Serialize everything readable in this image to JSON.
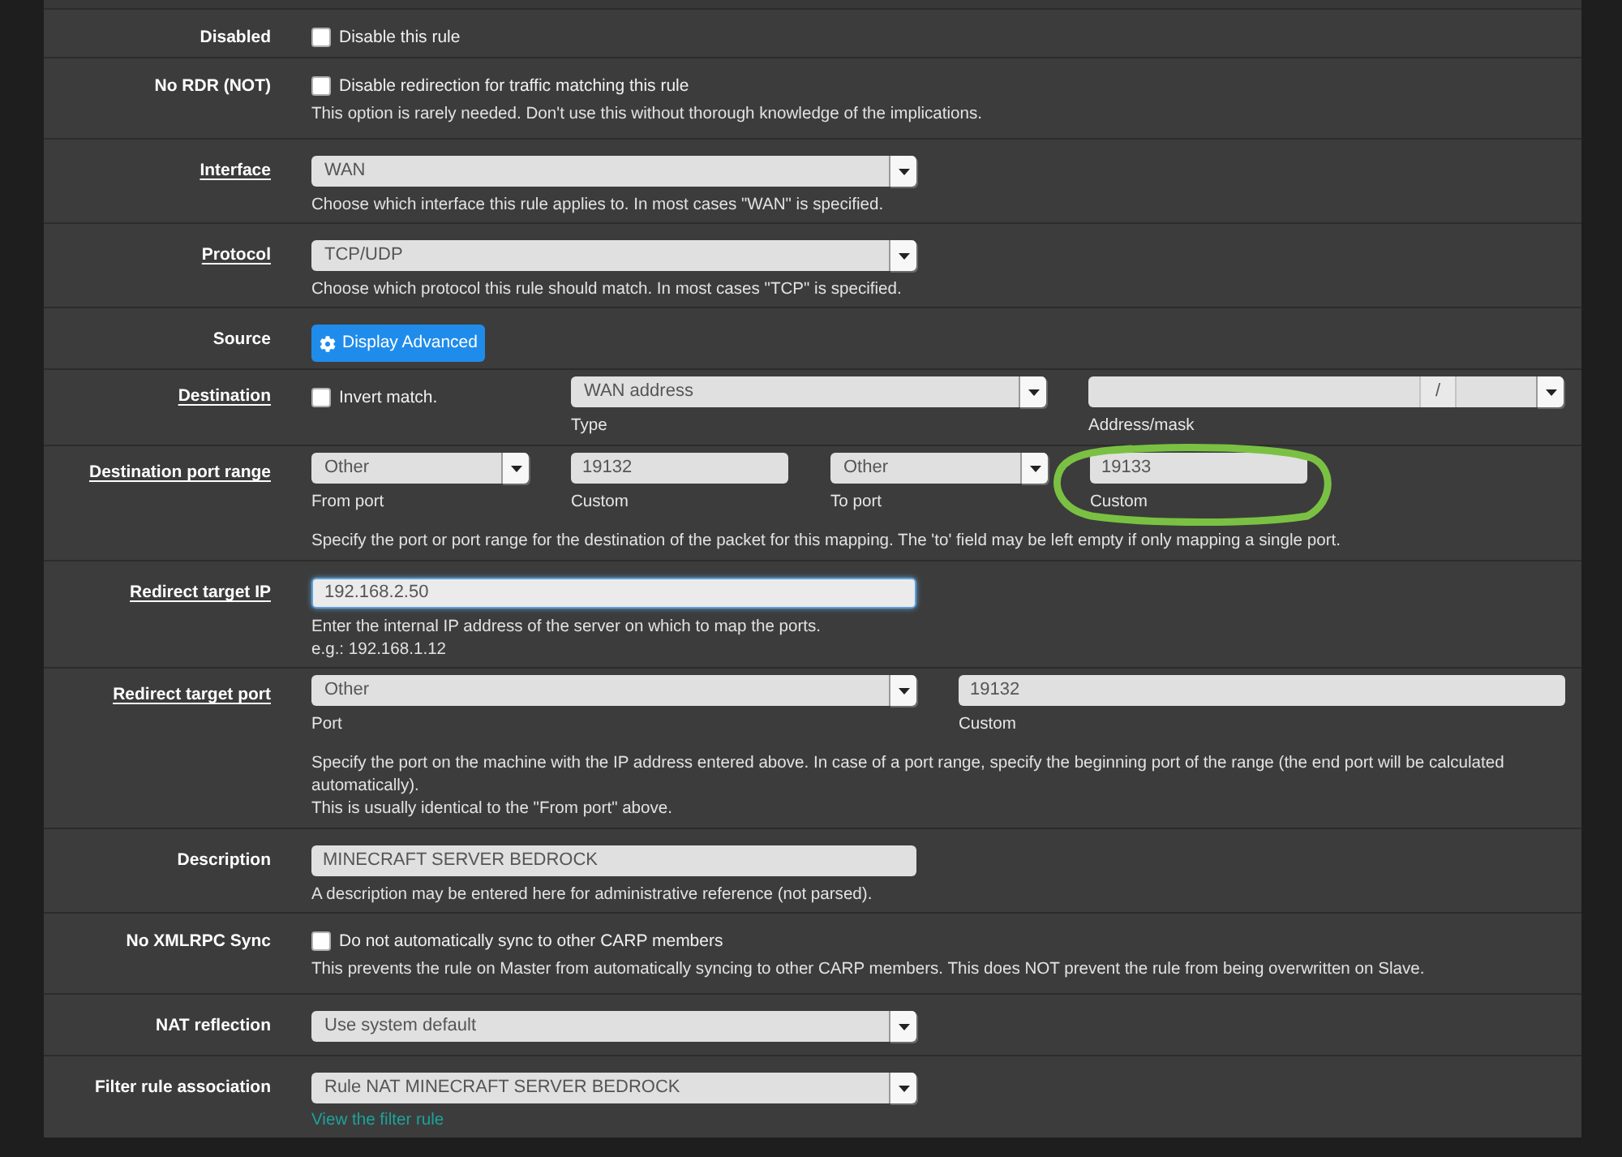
{
  "rows": [
    {
      "kind": "checkbox",
      "label": "Disabled",
      "required": false,
      "checkbox": {
        "label": "Disable this rule",
        "checked": false
      }
    },
    {
      "kind": "checkbox",
      "label": "No RDR (NOT)",
      "required": false,
      "checkbox": {
        "label": "Disable redirection for traffic matching this rule",
        "checked": false
      },
      "hints": [
        "This option is rarely needed. Don't use this without thorough knowledge of the implications."
      ]
    },
    {
      "kind": "select",
      "label": "Interface",
      "required": true,
      "select": {
        "value": "WAN"
      },
      "hints": [
        "Choose which interface this rule applies to. In most cases \"WAN\" is specified."
      ]
    },
    {
      "kind": "select",
      "label": "Protocol",
      "required": true,
      "select": {
        "value": "TCP/UDP"
      },
      "hints": [
        "Choose which protocol this rule should match. In most cases \"TCP\" is specified."
      ]
    },
    {
      "kind": "button",
      "label": "Source",
      "required": false,
      "button": {
        "label": "Display Advanced"
      }
    },
    {
      "kind": "destination",
      "label": "Destination",
      "required": true,
      "invert": {
        "label": "Invert match.",
        "checked": false
      },
      "type": {
        "value": "WAN address",
        "caption": "Type"
      },
      "address": {
        "separator": "/",
        "caption": "Address/mask"
      }
    },
    {
      "kind": "port_range",
      "label": "Destination port range",
      "required": true,
      "fields": [
        {
          "kind": "select",
          "value": "Other",
          "caption": "From port",
          "circled": false
        },
        {
          "kind": "input",
          "value": "19132",
          "caption": "Custom",
          "circled": false
        },
        {
          "kind": "select",
          "value": "Other",
          "caption": "To port",
          "circled": false
        },
        {
          "kind": "input",
          "value": "19133",
          "caption": "Custom",
          "circled": true
        }
      ],
      "hints": [
        "Specify the port or port range for the destination of the packet for this mapping. The 'to' field may be left empty if only mapping a single port."
      ]
    },
    {
      "kind": "input",
      "label": "Redirect target IP",
      "required": true,
      "input": {
        "value": "192.168.2.50",
        "focused": true
      },
      "hints": [
        "Enter the internal IP address of the server on which to map the ports.",
        "e.g.: 192.168.1.12"
      ]
    },
    {
      "kind": "port_pair",
      "label": "Redirect target port",
      "required": true,
      "fields": [
        {
          "kind": "select",
          "value": "Other",
          "caption": "Port"
        },
        {
          "kind": "input",
          "value": "19132",
          "caption": "Custom"
        }
      ],
      "hints": [
        "Specify the port on the machine with the IP address entered above. In case of a port range, specify the beginning port of the range (the end port will be calculated automatically).",
        "This is usually identical to the \"From port\" above."
      ]
    },
    {
      "kind": "input",
      "label": "Description",
      "required": false,
      "input": {
        "value": "MINECRAFT SERVER BEDROCK",
        "focused": false
      },
      "hints": [
        "A description may be entered here for administrative reference (not parsed)."
      ]
    },
    {
      "kind": "checkbox",
      "label": "No XMLRPC Sync",
      "required": false,
      "checkbox": {
        "label": "Do not automatically sync to other CARP members",
        "checked": false
      },
      "hints": [
        "This prevents the rule on Master from automatically syncing to other CARP members. This does NOT prevent the rule from being overwritten on Slave."
      ]
    },
    {
      "kind": "select",
      "label": "NAT reflection",
      "required": false,
      "select": {
        "value": "Use system default"
      }
    },
    {
      "kind": "select",
      "label": "Filter rule association",
      "required": false,
      "select": {
        "value": "Rule NAT MINECRAFT SERVER BEDROCK"
      },
      "link": "View the filter rule"
    }
  ]
}
